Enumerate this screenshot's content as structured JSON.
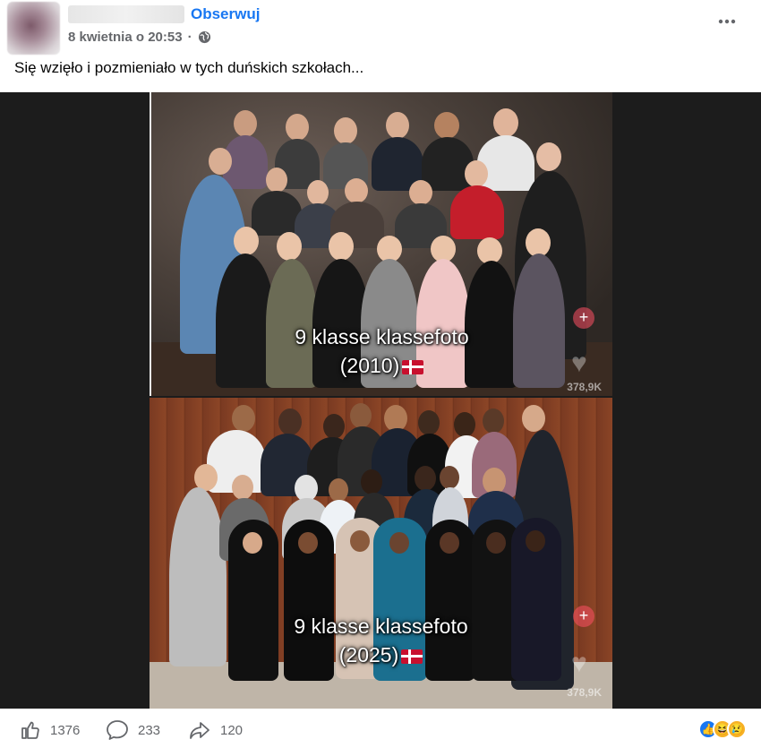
{
  "header": {
    "follow_label": "Obserwuj",
    "timestamp": "8 kwietnia o 20:53",
    "separator": "·",
    "privacy_icon": "globe-icon",
    "more_icon": "more-horizontal-icon"
  },
  "post": {
    "text": "Się wzięło i pozmieniało w tych duńskich szkołach..."
  },
  "media": {
    "top": {
      "title": "9 klasse klassefoto",
      "year": "(2010)",
      "views": "378,9K"
    },
    "bottom": {
      "title": "9 klasse klassefoto",
      "year": "(2025)",
      "views": "378,9K"
    }
  },
  "footer": {
    "likes": "1376",
    "comments": "233",
    "shares": "120",
    "reactions": [
      "like",
      "haha",
      "sad"
    ]
  },
  "colors": {
    "accent": "#1877f2",
    "muted": "#65676b",
    "media_bg": "#1c1c1c"
  }
}
